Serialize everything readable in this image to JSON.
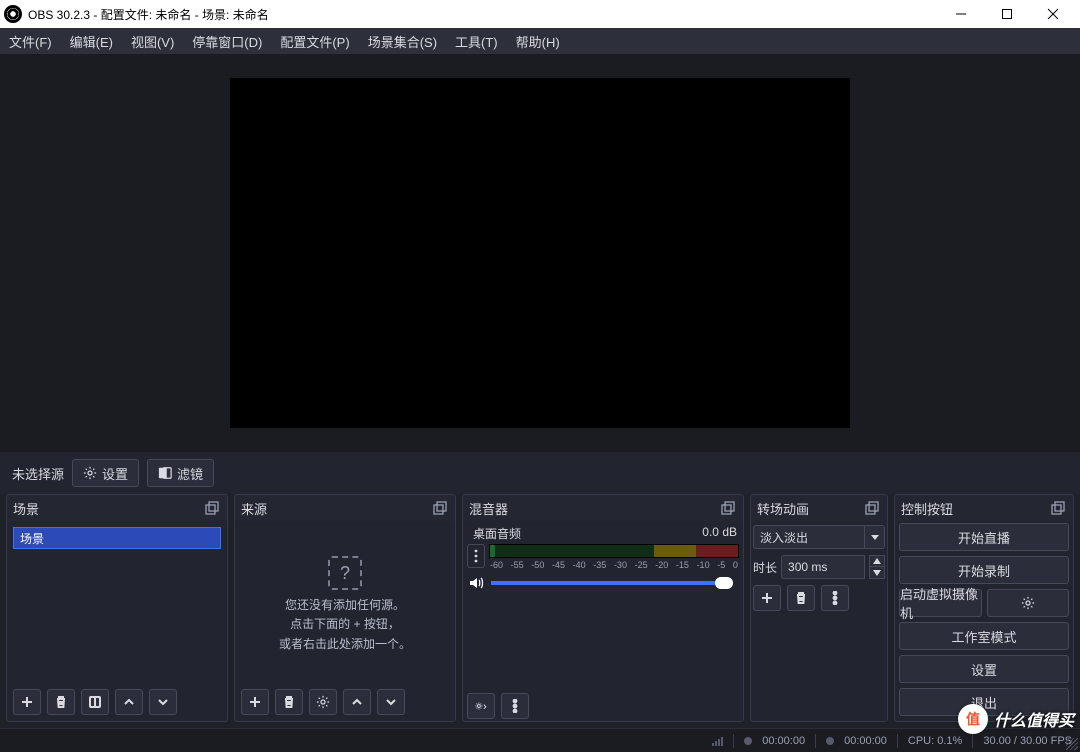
{
  "titlebar": {
    "title": "OBS 30.2.3 - 配置文件: 未命名 - 场景: 未命名"
  },
  "menubar": {
    "items": [
      "文件(F)",
      "编辑(E)",
      "视图(V)",
      "停靠窗口(D)",
      "配置文件(P)",
      "场景集合(S)",
      "工具(T)",
      "帮助(H)"
    ]
  },
  "contextbar": {
    "no_source": "未选择源",
    "settings": "设置",
    "filters": "滤镜"
  },
  "docks": {
    "scenes": {
      "title": "场景",
      "items": [
        "场景"
      ]
    },
    "sources": {
      "title": "来源",
      "empty_line1": "您还没有添加任何源。",
      "empty_line2": "点击下面的 + 按钮，",
      "empty_line3": "或者右击此处添加一个。"
    },
    "mixer": {
      "title": "混音器",
      "track_name": "桌面音频",
      "level": "0.0 dB",
      "ticks": [
        "-60",
        "-55",
        "-50",
        "-45",
        "-40",
        "-35",
        "-30",
        "-25",
        "-20",
        "-15",
        "-10",
        "-5",
        "0"
      ]
    },
    "transitions": {
      "title": "转场动画",
      "mode": "淡入淡出",
      "dur_label": "时长",
      "dur_value": "300 ms"
    },
    "controls": {
      "title": "控制按钮",
      "stream": "开始直播",
      "record": "开始录制",
      "vcam": "启动虚拟摄像机",
      "studio": "工作室模式",
      "settings": "设置",
      "exit": "退出"
    }
  },
  "status": {
    "live_time": "00:00:00",
    "rec_time": "00:00:00",
    "cpu": "CPU: 0.1%",
    "fps": "30.00 / 30.00 FPS"
  },
  "watermark": {
    "badge": "值",
    "text": "什么值得买"
  }
}
